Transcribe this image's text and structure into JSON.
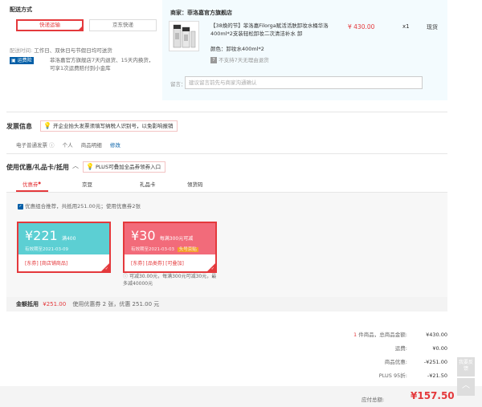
{
  "shipping": {
    "title": "配送方式",
    "options": [
      "快递运输",
      "京东快递"
    ],
    "time_label": "配送时间:",
    "time_value": "工作日、双休日与节假日均可送货",
    "return_badge": "运费险",
    "return_text": "菲洛嘉官方旗舰店7天内退货、15天内换货，可享1次运费赔付到小金库"
  },
  "shop": {
    "merchant_label": "商家：",
    "merchant_name": "菲洛嘉官方旗舰店",
    "product_title": "【38焕的节】菲洛嘉Filorga赋活活肤卸妆水桶华洛400ml*2支装轻松卸妆二次清洁补水 卸",
    "price": "¥ 430.00",
    "qty": "x1",
    "stock": "现货",
    "color_label": "颜色：",
    "color_value": "卸妆水400ml*2",
    "no_return": "不支持7天无理由退货",
    "note_label": "留言：",
    "note_placeholder": "建议留言前先与商家沟通确认"
  },
  "invoice": {
    "title": "发票信息",
    "tip": "开企业抬头发票须填写纳税人识别号，以免影响报销",
    "type": "电子普通发票",
    "info_icon": "ⓘ",
    "person": "个人",
    "detail": "商品明细",
    "edit": "修改"
  },
  "coupons": {
    "title": "使用优惠/礼品卡/抵用",
    "toggle": "︿",
    "tip": "PLUS可叠加全品券领券入口",
    "tabs": [
      "优惠券",
      "京豆",
      "礼品卡",
      "领货码"
    ],
    "tab_marker": "●",
    "combo_text": "优惠组合推荐，共抵用251.00元；使用优惠券2张",
    "list": [
      {
        "amount": "¥221",
        "condition": "满400",
        "valid": "有效期至2021-03-09",
        "tags": "[东券] [商店铺商品]"
      },
      {
        "amount": "¥30",
        "condition": "每满300元可减",
        "valid": "有效期至2021-03-03",
        "badge": "头号京贴",
        "tags": "[东券] [品类券] [可叠加]",
        "note": "可减30.00元，每满300元可减30元，最多减40000元"
      }
    ],
    "summary_prefix": "金额抵用",
    "summary_amount": "¥251.00",
    "summary_suffix": "使用优惠券 2 张，优惠 251.00 元"
  },
  "totals": {
    "count_prefix": "1",
    "count_suffix": "件商品，总商品金额:",
    "goods_total": "¥430.00",
    "freight_label": "运费:",
    "freight": "¥0.00",
    "discount_label": "商品优惠:",
    "discount": "-¥251.00",
    "plus_label": "PLUS 95折:",
    "plus": "-¥21.50",
    "payable_label": "应付总额:",
    "payable": "¥157.50"
  },
  "side": {
    "feedback": "我要反馈",
    "top": "︿"
  },
  "colors": {
    "accent_red": "#e4393c",
    "link_blue": "#005ea7",
    "coupon_teal": "#5ccfd3",
    "coupon_pink": "#f26b7a",
    "badge_orange": "#f5a623"
  }
}
